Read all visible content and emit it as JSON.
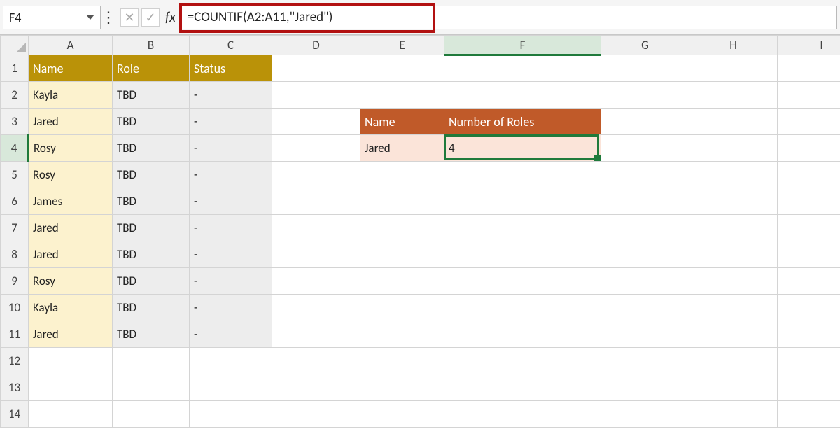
{
  "namebox": {
    "value": "F4"
  },
  "formula_bar": {
    "fx_label": "fx",
    "formula": "=COUNTIF(A2:A11,\"Jared\")"
  },
  "columns": [
    "A",
    "B",
    "C",
    "D",
    "E",
    "F",
    "G",
    "H",
    "I"
  ],
  "rows": [
    "1",
    "2",
    "3",
    "4",
    "5",
    "6",
    "7",
    "8",
    "9",
    "10",
    "11",
    "12",
    "13",
    "14"
  ],
  "table_main": {
    "headers": {
      "name": "Name",
      "role": "Role",
      "status": "Status"
    },
    "rows": [
      {
        "name": "Kayla",
        "role": "TBD",
        "status": "-"
      },
      {
        "name": "Jared",
        "role": "TBD",
        "status": "-"
      },
      {
        "name": "Rosy",
        "role": "TBD",
        "status": "-"
      },
      {
        "name": "Rosy",
        "role": "TBD",
        "status": "-"
      },
      {
        "name": "James",
        "role": "TBD",
        "status": "-"
      },
      {
        "name": "Jared",
        "role": "TBD",
        "status": "-"
      },
      {
        "name": "Jared",
        "role": "TBD",
        "status": "-"
      },
      {
        "name": "Rosy",
        "role": "TBD",
        "status": "-"
      },
      {
        "name": "Kayla",
        "role": "TBD",
        "status": "-"
      },
      {
        "name": "Jared",
        "role": "TBD",
        "status": "-"
      }
    ]
  },
  "summary": {
    "headers": {
      "name": "Name",
      "count": "Number of Roles"
    },
    "row": {
      "name": "Jared",
      "count": "4"
    }
  },
  "active_cell": "F4",
  "colors": {
    "gold": "#ba9208",
    "peach_bg": "#fcf2ce",
    "orange": "#c05a29",
    "light_peach": "#fbe4d9",
    "select_green": "#1f7a3b",
    "highlight_red": "#b21111"
  }
}
